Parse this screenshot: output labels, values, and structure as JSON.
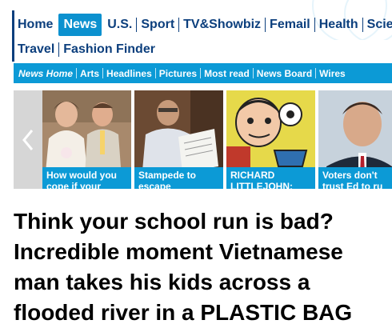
{
  "nav": {
    "items": [
      {
        "label": "Home",
        "active": false
      },
      {
        "label": "News",
        "active": true
      },
      {
        "label": "U.S.",
        "active": false
      },
      {
        "label": "Sport",
        "active": false
      },
      {
        "label": "TV&Showbiz",
        "active": false
      },
      {
        "label": "Femail",
        "active": false
      },
      {
        "label": "Health",
        "active": false
      },
      {
        "label": "Scienc",
        "active": false
      }
    ],
    "row2": [
      {
        "label": "Travel"
      },
      {
        "label": "Fashion Finder"
      }
    ]
  },
  "subnav": {
    "items": [
      "News Home",
      "Arts",
      "Headlines",
      "Pictures",
      "Most read",
      "News Board",
      "Wires"
    ]
  },
  "carousel": {
    "prev_icon": "chevron-left-icon",
    "cards": [
      {
        "caption": "How would you cope if your",
        "image": "wedding-couple-photo"
      },
      {
        "caption": "Stampede to escape",
        "image": "man-reading-paper-photo"
      },
      {
        "caption": "RICHARD LITTLEJOHN:",
        "image": "cartoon-illustration"
      },
      {
        "caption": "Voters don't trust Ed to ru",
        "image": "politician-portrait-photo"
      }
    ]
  },
  "headline": "Think your school run is bad? Incredible moment Vietnamese man takes his kids across a flooded river in a PLASTIC BAG",
  "colors": {
    "brand_dark": "#0c3f7d",
    "accent": "#0c9ad6"
  }
}
